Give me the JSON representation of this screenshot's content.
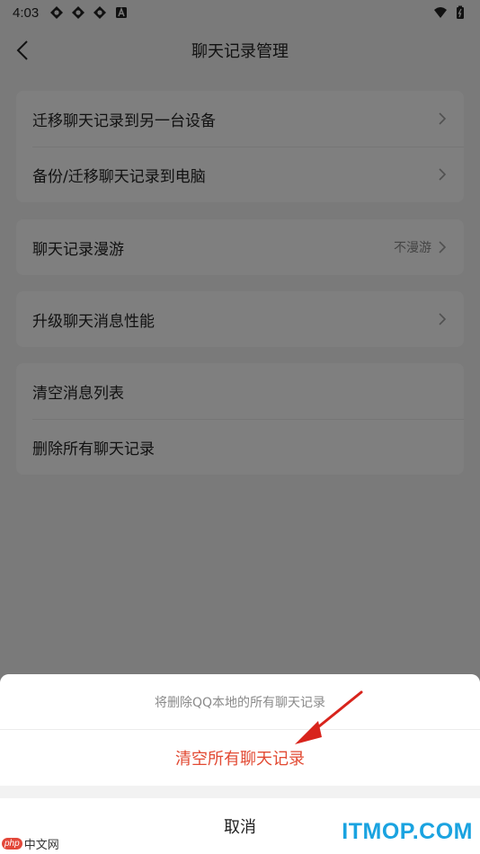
{
  "status_bar": {
    "time": "4:03",
    "icons": [
      "sync-icon",
      "sync-icon",
      "sync-icon",
      "a-badge-icon",
      "wifi-icon",
      "battery-icon"
    ]
  },
  "header": {
    "title": "聊天记录管理",
    "back_icon": "chevron-left-icon"
  },
  "groups": [
    {
      "rows": [
        {
          "label": "迁移聊天记录到另一台设备",
          "value": ""
        },
        {
          "label": "备份/迁移聊天记录到电脑",
          "value": ""
        }
      ]
    },
    {
      "rows": [
        {
          "label": "聊天记录漫游",
          "value": "不漫游"
        }
      ]
    },
    {
      "rows": [
        {
          "label": "升级聊天消息性能",
          "value": ""
        }
      ]
    },
    {
      "rows": [
        {
          "label": "清空消息列表",
          "value": ""
        },
        {
          "label": "删除所有聊天记录",
          "value": ""
        }
      ]
    }
  ],
  "action_sheet": {
    "message": "将删除QQ本地的所有聊天记录",
    "confirm_label": "清空所有聊天记录",
    "cancel_label": "取消"
  },
  "watermarks": {
    "left_badge": "php",
    "left_text": "中文网",
    "right_text": "ITMOP.COM"
  },
  "colors": {
    "danger": "#e24a33",
    "watermark_blue": "#1aa3e0",
    "arrow_red": "#d8241c"
  }
}
